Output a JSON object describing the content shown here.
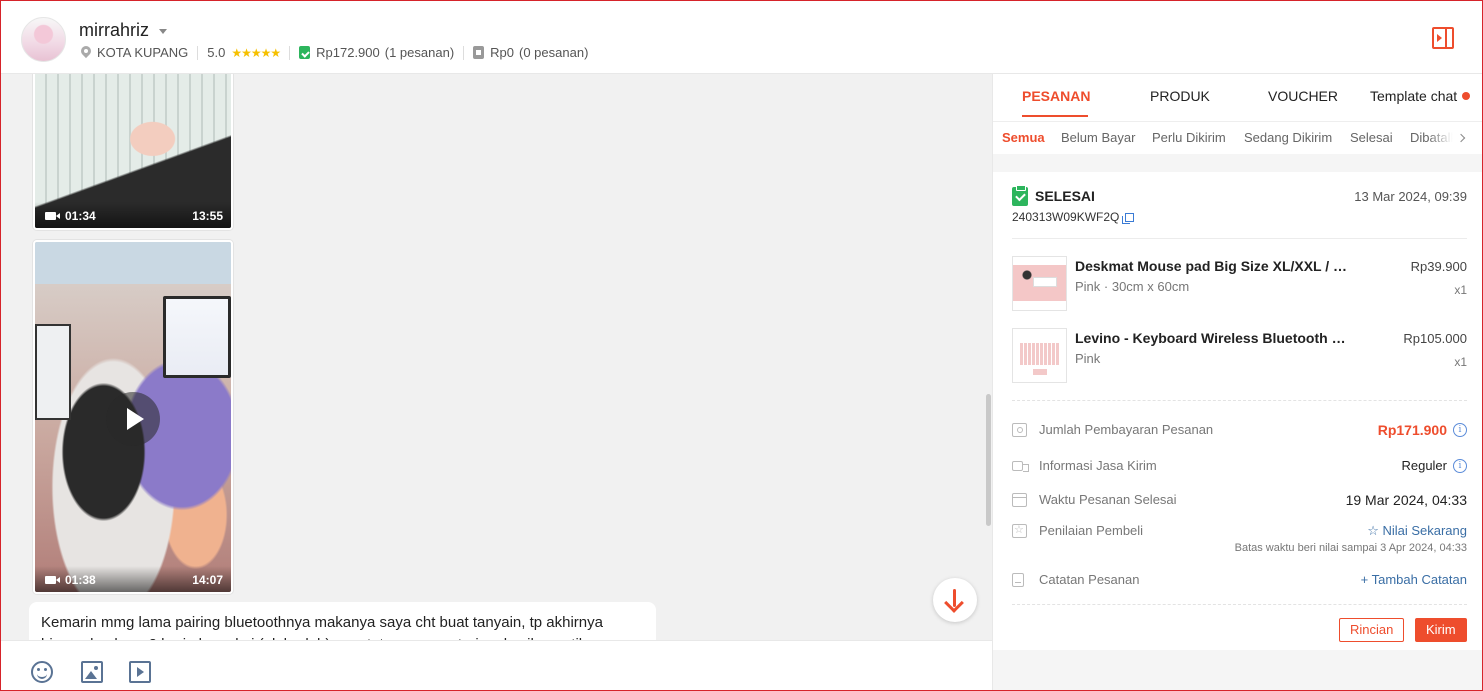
{
  "header": {
    "username": "mirrahriz",
    "location": "KOTA KUPANG",
    "rating": "5.0",
    "stars": "★★★★★",
    "completed_amount": "Rp172.900",
    "completed_count": "(1 pesanan)",
    "other_amount": "Rp0",
    "other_count": "(0 pesanan)"
  },
  "chat": {
    "videos": [
      {
        "duration": "01:34",
        "time": "13:55"
      },
      {
        "duration": "01:38",
        "time": "14:07"
      }
    ],
    "message": "Kemarin mmg lama pairing bluetoothnya makanya saya cht buat tanyain, tp akhirnya bisa... dan baru 2 hari aku pakai (oleh-oleh) ya... tetap senang terima kasih, pastikan dikirim"
  },
  "panel": {
    "tabs": [
      "PESANAN",
      "PRODUK",
      "VOUCHER",
      "Template chat"
    ],
    "subtabs": [
      "Semua",
      "Belum Bayar",
      "Perlu Dikirim",
      "Sedang Dikirim",
      "Selesai",
      "Dibatalkan"
    ],
    "order": {
      "status": "SELESAI",
      "date": "13 Mar 2024, 09:39",
      "id": "240313W09KWF2Q",
      "items": [
        {
          "name": "Deskmat Mouse pad Big Size XL/XXL / Gaming",
          "variant": "Pink · 30cm x 60cm",
          "price": "Rp39.900",
          "qty": "x1"
        },
        {
          "name": "Levino - Keyboard Wireless Bluetooth Mini Bulat",
          "variant": "Pink",
          "price": "Rp105.000",
          "qty": "x1"
        }
      ],
      "payment_label": "Jumlah Pembayaran Pesanan",
      "payment_value": "Rp171.900",
      "shipping_label": "Informasi Jasa Kirim",
      "shipping_value": "Reguler",
      "completed_label": "Waktu Pesanan Selesai",
      "completed_value": "19 Mar 2024, 04:33",
      "review_label": "Penilaian Pembeli",
      "review_value": "☆ Nilai Sekarang",
      "review_note": "Batas waktu beri nilai sampai 3 Apr 2024, 04:33",
      "note_label": "Catatan Pesanan",
      "note_value": "+ Tambah Catatan",
      "btn_detail": "Rincian",
      "btn_send": "Kirim"
    }
  },
  "colors": {
    "accent": "#ee4d2d",
    "success": "#2db55d",
    "link": "#3a6ea5"
  }
}
